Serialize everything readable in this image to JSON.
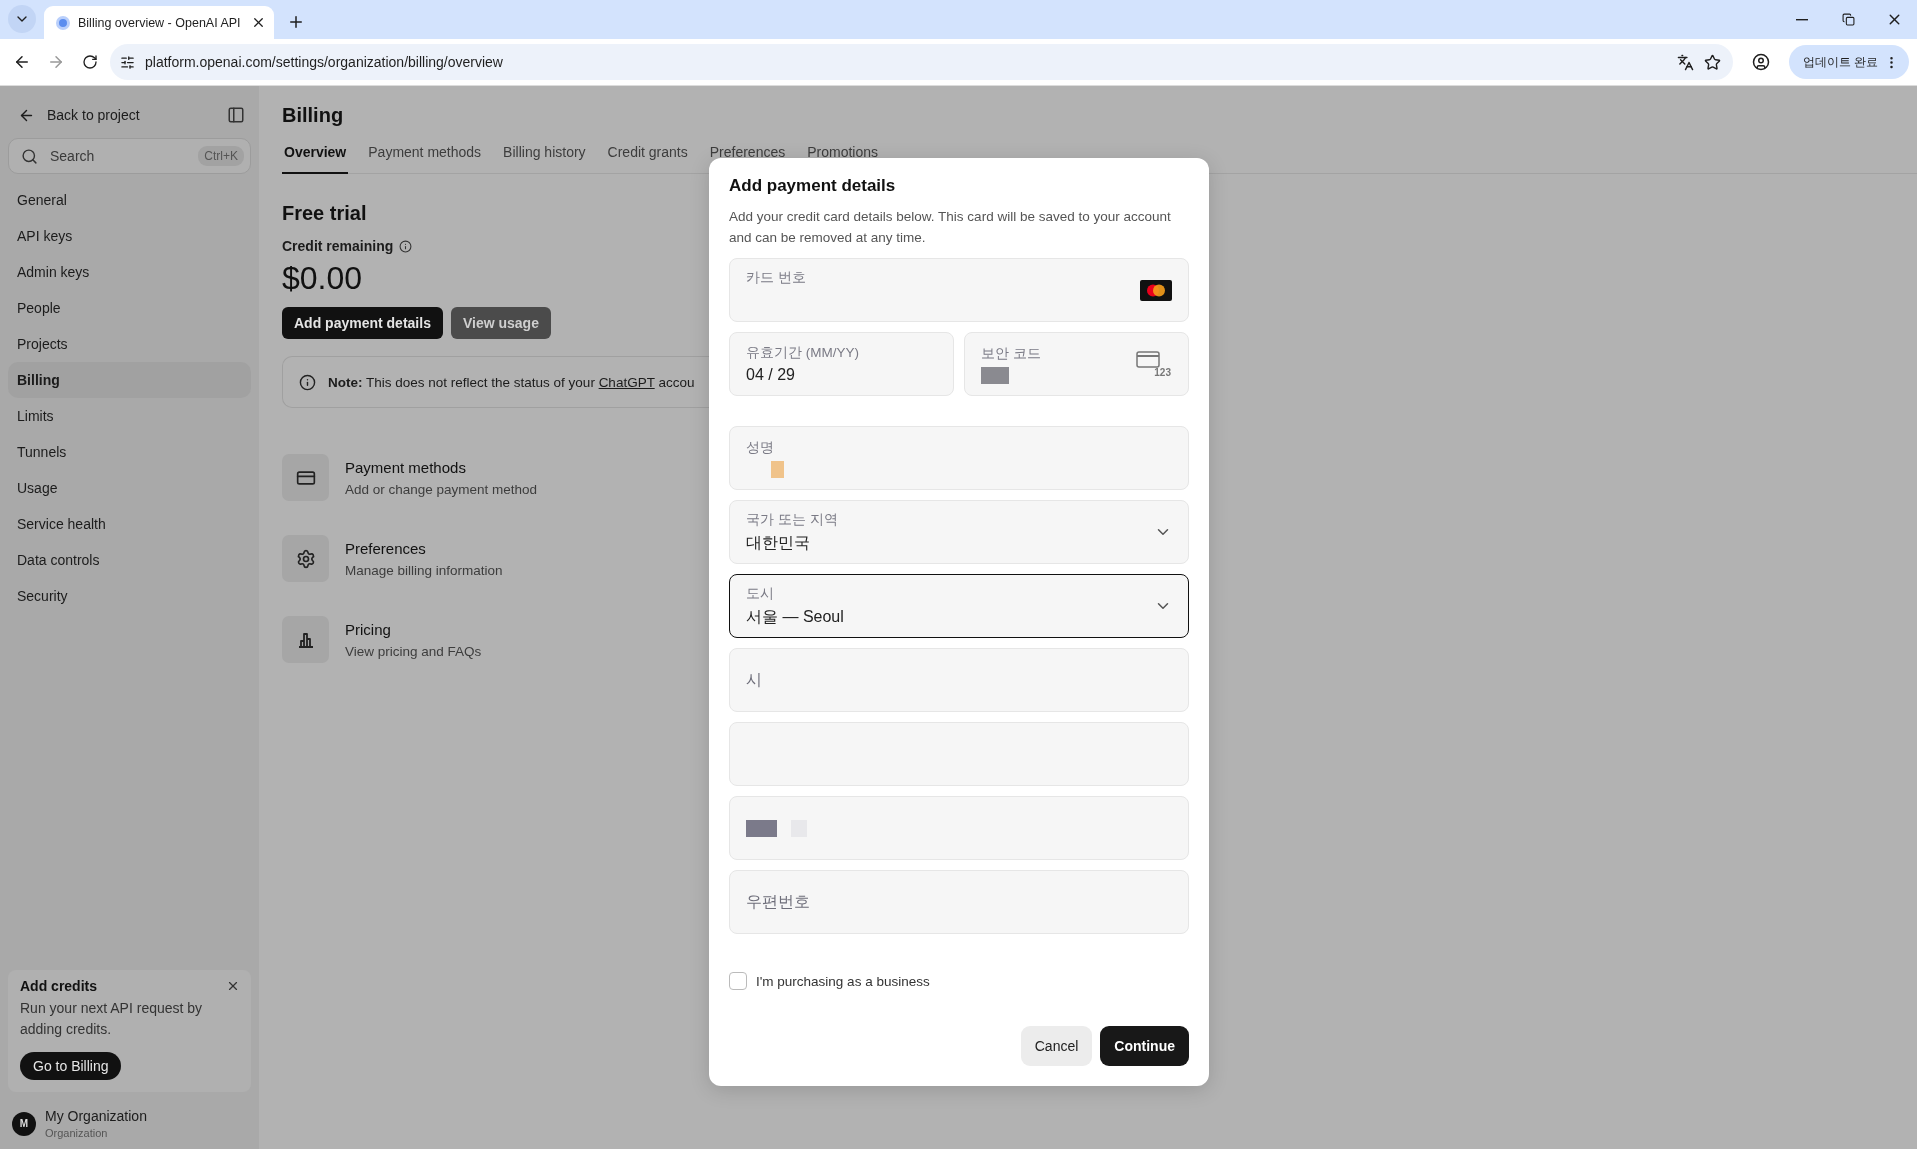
{
  "browser": {
    "tab_title": "Billing overview - OpenAI API",
    "url": "platform.openai.com/settings/organization/billing/overview",
    "update_button": "업데이트 완료"
  },
  "sidebar": {
    "back": "Back to project",
    "search": {
      "placeholder": "Search",
      "shortcut": "Ctrl+K"
    },
    "items": [
      {
        "label": "General",
        "selected": false
      },
      {
        "label": "API keys",
        "selected": false
      },
      {
        "label": "Admin keys",
        "selected": false
      },
      {
        "label": "People",
        "selected": false
      },
      {
        "label": "Projects",
        "selected": false
      },
      {
        "label": "Billing",
        "selected": true
      },
      {
        "label": "Limits",
        "selected": false
      },
      {
        "label": "Tunnels",
        "selected": false
      },
      {
        "label": "Usage",
        "selected": false
      },
      {
        "label": "Service health",
        "selected": false
      },
      {
        "label": "Data controls",
        "selected": false
      },
      {
        "label": "Security",
        "selected": false
      }
    ],
    "promo": {
      "title": "Add credits",
      "text": "Run your next API request by adding credits.",
      "button": "Go to Billing"
    },
    "org": {
      "avatar": "M",
      "name": "My Organization",
      "role": "Organization"
    }
  },
  "main": {
    "title": "Billing",
    "tabs": [
      {
        "label": "Overview",
        "selected": true
      },
      {
        "label": "Payment methods",
        "selected": false
      },
      {
        "label": "Billing history",
        "selected": false
      },
      {
        "label": "Credit grants",
        "selected": false
      },
      {
        "label": "Preferences",
        "selected": false
      },
      {
        "label": "Promotions",
        "selected": false
      }
    ],
    "plan": "Free trial",
    "credit_label": "Credit remaining",
    "credit_amount": "$0.00",
    "buttons": [
      {
        "label": "Add payment details",
        "kind": "primary"
      },
      {
        "label": "View usage",
        "kind": "secondary"
      }
    ],
    "note": {
      "text": "**Note:** This does not reflect the status of your ",
      "link": "ChatGPT",
      "tail": " accou"
    },
    "links": [
      {
        "kind": "card",
        "title": "Payment methods",
        "subtitle": "Add or change payment method"
      },
      {
        "kind": "gear",
        "title": "Preferences",
        "subtitle": "Manage billing information"
      },
      {
        "kind": "chart",
        "title": "Pricing",
        "subtitle": "View pricing and FAQs"
      }
    ]
  },
  "dialog": {
    "title": "Add payment details",
    "description": "Add your credit card details below. This card will be saved to your account and can be removed at any time.",
    "rows": [
      [
        {
          "kind": "card",
          "label": "카드 번호"
        }
      ],
      [
        {
          "kind": "text",
          "label": "유효기간 (MM/YY)",
          "value": "04 / 29"
        },
        {
          "kind": "cvc",
          "label": "보안 코드",
          "icon_text": "123"
        }
      ],
      [
        {
          "kind": "name",
          "label": "성명"
        }
      ],
      [
        {
          "kind": "select",
          "label": "국가 또는 지역",
          "value": "대한민국",
          "focused": false
        }
      ],
      [
        {
          "kind": "select",
          "label": "도시",
          "value": "서울 — Seoul",
          "focused": true
        }
      ],
      [
        {
          "kind": "placeholder",
          "placeholder": "시"
        }
      ],
      [
        {
          "kind": "blank"
        }
      ],
      [
        {
          "kind": "masked"
        }
      ],
      [
        {
          "kind": "placeholder",
          "placeholder": "우편번호"
        }
      ]
    ],
    "checkbox": {
      "label": "I'm purchasing as a business",
      "checked": false
    },
    "buttons": [
      {
        "label": "Cancel",
        "kind": "secondary"
      },
      {
        "label": "Continue",
        "kind": "primary"
      }
    ]
  }
}
